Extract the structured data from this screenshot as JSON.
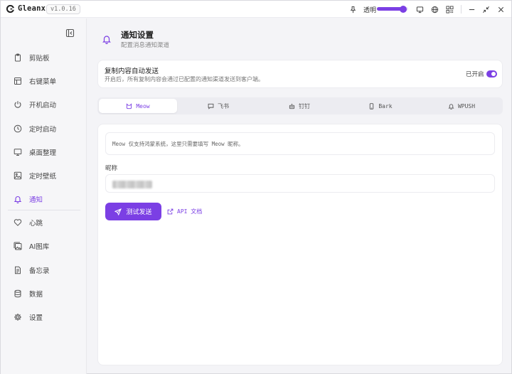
{
  "app": {
    "name": "Gleanx",
    "version": "v1.0.16",
    "opacity_label": "透明",
    "opacity_level": 0.85
  },
  "titlebar_icons": [
    "pin-icon",
    "monitor-icon",
    "globe-icon",
    "qr-code-icon",
    "minimize-icon",
    "shrink-icon",
    "close-icon"
  ],
  "sidebar": {
    "items": [
      {
        "label": "剪贴板",
        "icon": "clipboard-icon"
      },
      {
        "label": "右键菜单",
        "icon": "context-menu-icon"
      },
      {
        "label": "开机启动",
        "icon": "power-icon"
      },
      {
        "label": "定时启动",
        "icon": "clock-icon"
      },
      {
        "label": "桌面整理",
        "icon": "monitor-icon"
      },
      {
        "label": "定时壁纸",
        "icon": "image-icon"
      },
      {
        "label": "通知",
        "icon": "bell-icon",
        "active": true
      },
      {
        "label": "心跳",
        "icon": "heart-icon"
      },
      {
        "label": "AI图库",
        "icon": "gallery-icon"
      },
      {
        "label": "备忘录",
        "icon": "memo-icon"
      },
      {
        "label": "数据",
        "icon": "database-icon"
      },
      {
        "label": "设置",
        "icon": "gear-icon"
      }
    ]
  },
  "main": {
    "title": "通知设置",
    "subtitle": "配置消息通知渠道",
    "auto_send": {
      "title": "复制内容自动发送",
      "description": "开启后，所有复制内容会通过已配置的通知渠道发送到客户端。",
      "status": "已开启",
      "enabled": true
    },
    "tabs": [
      {
        "label": "Meow",
        "icon": "cat-icon",
        "active": true
      },
      {
        "label": "飞书",
        "icon": "chat-icon"
      },
      {
        "label": "钉钉",
        "icon": "robot-icon"
      },
      {
        "label": "Bark",
        "icon": "phone-icon"
      },
      {
        "label": "WPUSH",
        "icon": "bell-icon"
      }
    ],
    "panel": {
      "info": "Meow 仅支持鸿蒙系统，这里只需要填写 Meow 昵称。",
      "field_label": "昵称",
      "send_button": "测试发送",
      "api_link": "API 文档"
    }
  },
  "colors": {
    "accent": "#7b3fe4"
  }
}
